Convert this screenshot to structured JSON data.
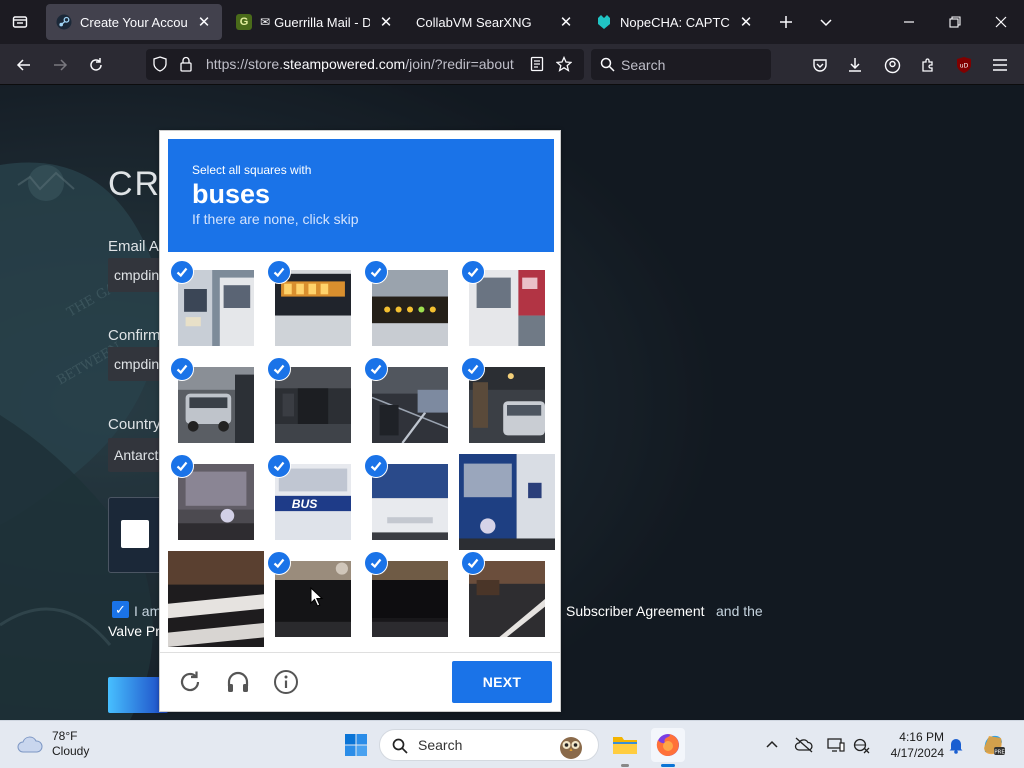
{
  "browser": {
    "tabs": [
      {
        "label": "Create Your Account",
        "active": true
      },
      {
        "label": "Guerrilla Mail - Disp",
        "active": false
      },
      {
        "label": "CollabVM SearXNG",
        "active": false
      },
      {
        "label": "NopeCHA: CAPTCHA S",
        "active": false
      }
    ],
    "url_prefix": "https://store.",
    "url_domain": "steampowered.com",
    "url_path": "/join/?redir=about",
    "search_placeholder": "Search"
  },
  "steam": {
    "title": "CRE",
    "email_label": "Email Ad",
    "email_value": "cmpdin",
    "confirm_label": "Confirm",
    "confirm_value": "cmpdin",
    "country_label": "Country",
    "country_value": "Antarct",
    "agree_text": "I am",
    "agree_link": "Subscriber Agreement",
    "agree_after": "and the",
    "valve_link": "Valve Pr"
  },
  "recaptcha": {
    "instruction": "Select all squares with",
    "keyword": "buses",
    "subtext": "If there are none, click skip",
    "next_label": "NEXT",
    "tiles": [
      {
        "selected": true,
        "scene": "bus-front"
      },
      {
        "selected": true,
        "scene": "bus-display"
      },
      {
        "selected": true,
        "scene": "bus-lights"
      },
      {
        "selected": true,
        "scene": "bus-side"
      },
      {
        "selected": true,
        "scene": "street-car"
      },
      {
        "selected": true,
        "scene": "street-dark"
      },
      {
        "selected": true,
        "scene": "street-wire"
      },
      {
        "selected": true,
        "scene": "street-car2"
      },
      {
        "selected": true,
        "scene": "bus-blur"
      },
      {
        "selected": true,
        "scene": "bus-label"
      },
      {
        "selected": true,
        "scene": "bus-body"
      },
      {
        "selected": false,
        "scene": "bus-corner"
      },
      {
        "selected": false,
        "scene": "road-crossing"
      },
      {
        "selected": true,
        "scene": "road-dark"
      },
      {
        "selected": true,
        "scene": "road-dark2"
      },
      {
        "selected": true,
        "scene": "road-line"
      }
    ],
    "bus_sign": "BUS"
  },
  "taskbar": {
    "temperature": "78°F",
    "condition": "Cloudy",
    "search_label": "Search",
    "time": "4:16 PM",
    "date": "4/17/2024"
  }
}
